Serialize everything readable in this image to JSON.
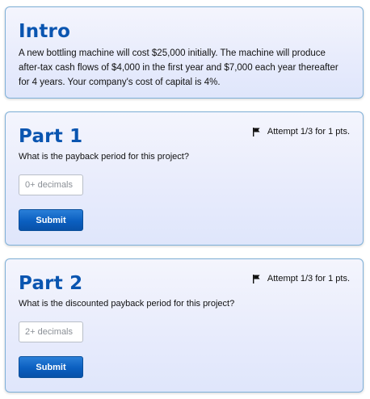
{
  "intro": {
    "title": "Intro",
    "text": "A new bottling machine will cost $25,000 initially. The machine will produce after-tax cash flows of $4,000 in the first year and $7,000 each year thereafter for 4 years. Your company's cost of capital is 4%."
  },
  "parts": [
    {
      "title": "Part 1",
      "attempt": "Attempt 1/3 for 1 pts.",
      "question": "What is the payback period for this project?",
      "input_placeholder": "0+ decimals",
      "input_value": "",
      "submit_label": "Submit"
    },
    {
      "title": "Part 2",
      "attempt": "Attempt 1/3 for 1 pts.",
      "question": "What is the discounted payback period for this project?",
      "input_placeholder": "2+ decimals",
      "input_value": "",
      "submit_label": "Submit"
    }
  ],
  "icons": {
    "attempt_flag": "flag-icon"
  },
  "colors": {
    "title": "#0a55b0",
    "submit": "#0b5fc0",
    "card_border": "#7fb0d8"
  }
}
